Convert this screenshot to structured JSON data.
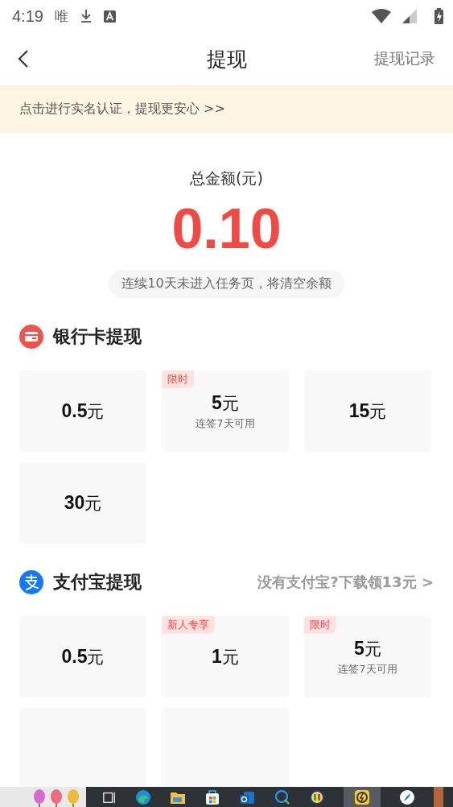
{
  "status_bar": {
    "time": "4:19",
    "notification": "唯"
  },
  "header": {
    "title": "提现",
    "action": "提现记录"
  },
  "banner": {
    "text": "点击进行实名认证，提现更安心 >>"
  },
  "balance": {
    "label": "总金额(元)",
    "amount": "0.10",
    "notice": "连续10天未进入任务页，将清空余额"
  },
  "sections": [
    {
      "kind": "bank",
      "title": "银行卡提现",
      "options": [
        {
          "kind": "amount",
          "amount": "0.5",
          "unit": "元"
        },
        {
          "kind": "amount",
          "amount": "5",
          "unit": "元",
          "tag": "限时",
          "note": "连签7天可用"
        },
        {
          "kind": "amount",
          "amount": "15",
          "unit": "元"
        },
        {
          "kind": "amount",
          "amount": "30",
          "unit": "元"
        }
      ]
    },
    {
      "kind": "alipay",
      "title": "支付宝提现",
      "link": "没有支付宝?下载领13元 >",
      "options": [
        {
          "kind": "amount",
          "amount": "0.5",
          "unit": "元"
        },
        {
          "kind": "amount",
          "amount": "1",
          "unit": "元",
          "tag": "新人专享"
        },
        {
          "kind": "amount",
          "amount": "5",
          "unit": "元",
          "tag": "限时",
          "note": "连签7天可用"
        },
        {
          "kind": "empty"
        },
        {
          "kind": "empty"
        }
      ]
    }
  ]
}
